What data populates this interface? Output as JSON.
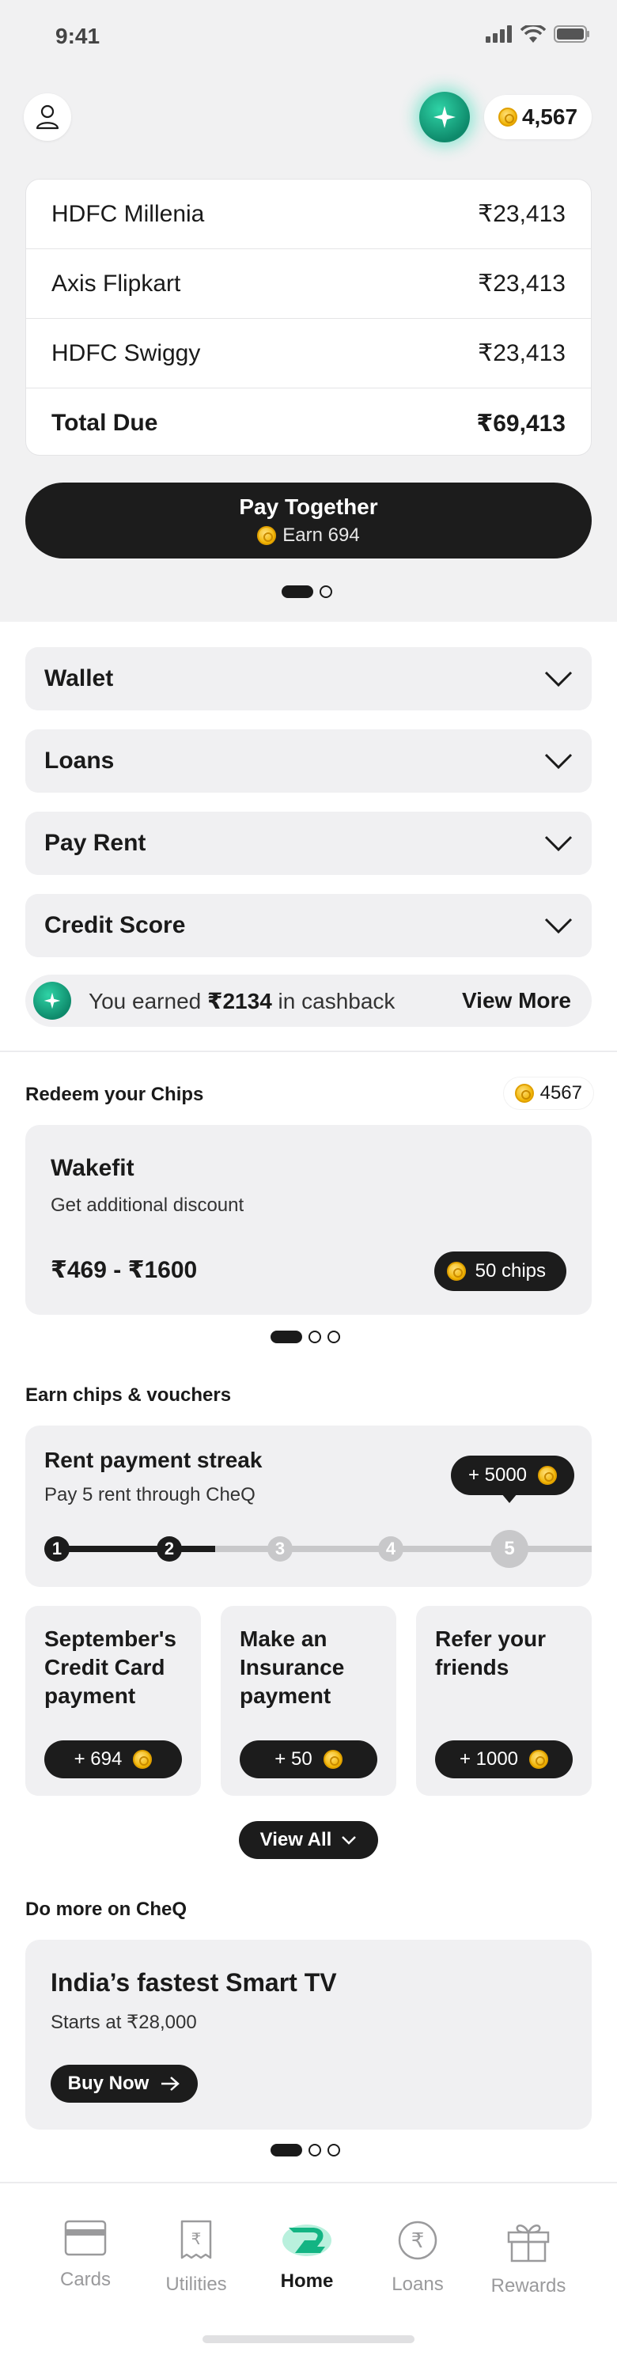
{
  "status": {
    "time": "9:41"
  },
  "header": {
    "chips_balance": "4,567"
  },
  "cards": [
    {
      "name": "HDFC Millenia",
      "amount": "₹23,413"
    },
    {
      "name": "Axis Flipkart",
      "amount": "₹23,413"
    },
    {
      "name": "HDFC Swiggy",
      "amount": "₹23,413"
    },
    {
      "name": "Total Due",
      "amount": "₹69,413"
    }
  ],
  "pay_button": {
    "label": "Pay Together",
    "earn": "Earn 694"
  },
  "accordions": [
    "Wallet",
    "Loans",
    "Pay Rent",
    "Credit Score"
  ],
  "cashback": {
    "prefix": "You earned ",
    "amount": "₹2134",
    "suffix": " in cashback",
    "cta": "View More"
  },
  "redeem": {
    "title": "Redeem your Chips",
    "chip_count": "4567",
    "offer": {
      "brand": "Wakefit",
      "description": "Get additional discount",
      "price": "₹469 - ₹1600",
      "chips": "50 chips"
    }
  },
  "earn": {
    "title": "Earn chips & vouchers",
    "streak": {
      "title": "Rent payment streak",
      "subtitle": "Pay 5 rent through CheQ",
      "reward": "+ 5000",
      "steps": [
        "1",
        "2",
        "3",
        "4",
        "5"
      ]
    },
    "tasks": [
      {
        "title": "September's Credit Card payment",
        "reward": "+ 694"
      },
      {
        "title": "Make an Insurance payment",
        "reward": "+ 50"
      },
      {
        "title": "Refer your friends",
        "reward": "+ 1000"
      }
    ],
    "view_all": "View All"
  },
  "more": {
    "title": "Do more on CheQ",
    "promo": {
      "title": "India’s fastest Smart TV",
      "subtitle": "Starts at ₹28,000",
      "cta": "Buy Now"
    }
  },
  "nav": [
    {
      "label": "Cards",
      "icon": "card-icon"
    },
    {
      "label": "Utilities",
      "icon": "bill-icon"
    },
    {
      "label": "Home",
      "icon": "home-logo-icon"
    },
    {
      "label": "Loans",
      "icon": "rupee-icon"
    },
    {
      "label": "Rewards",
      "icon": "gift-icon"
    }
  ],
  "colors": {
    "accent": "#1fc49a",
    "dark": "#1c1c1c",
    "coin": "#f0b300"
  }
}
